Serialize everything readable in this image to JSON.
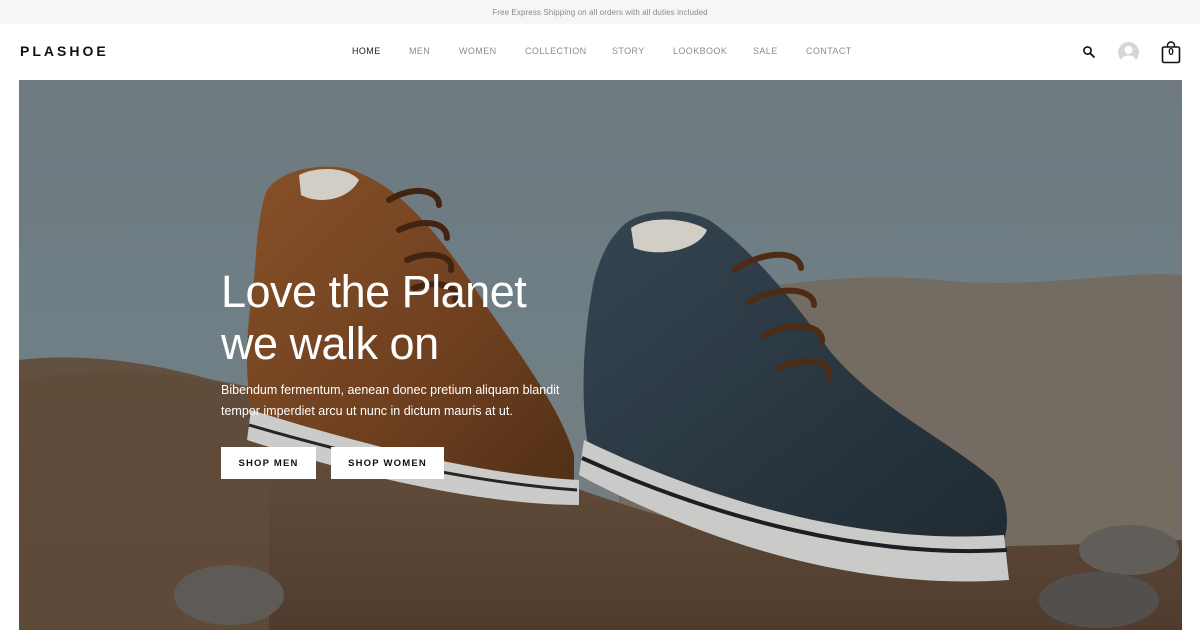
{
  "announcement": "Free Express Shipping on all orders with all duties included",
  "brand": "PLASHOE",
  "nav": [
    {
      "label": "HOME",
      "active": true
    },
    {
      "label": "MEN",
      "active": false
    },
    {
      "label": "WOMEN",
      "active": false
    },
    {
      "label": "COLLECTION",
      "active": false
    },
    {
      "label": "STORY",
      "active": false
    },
    {
      "label": "LOOKBOOK",
      "active": false
    },
    {
      "label": "SALE",
      "active": false
    },
    {
      "label": "CONTACT",
      "active": false
    }
  ],
  "header_icons": {
    "search": "search-icon",
    "account": "user-avatar-icon",
    "cart": "shopping-bag-icon"
  },
  "cart_count": "0",
  "hero": {
    "title_line1": "Love the Planet",
    "title_line2": "we walk on",
    "subtitle": "Bibendum fermentum, aenean donec pretium aliquam blandit tempor imperdiet arcu ut nunc in dictum mauris at ut.",
    "buttons": {
      "shop_men": "SHOP MEN",
      "shop_women": "SHOP WOMEN"
    }
  },
  "colors": {
    "nav_active": "#222222",
    "nav_inactive": "#8c8c8c",
    "button_bg": "#ffffff",
    "hero_text": "#ffffff"
  }
}
